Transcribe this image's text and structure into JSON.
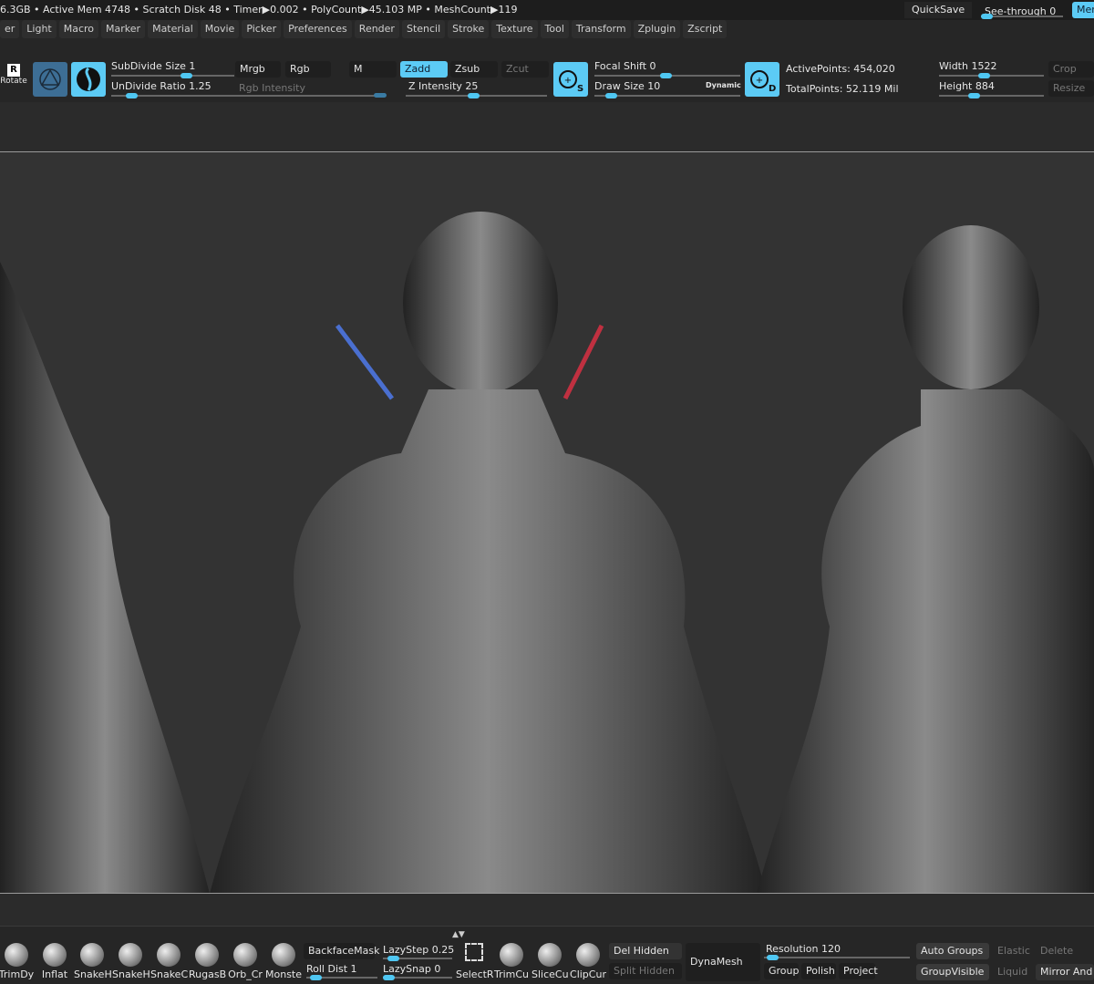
{
  "status": {
    "text": "6.3GB • Active Mem 4748 • Scratch Disk 48 •  Timer▶0.002 • PolyCount▶45.103 MP  • MeshCount▶119",
    "quicksave": "QuickSave",
    "see_through": "See-through  0",
    "see_through_value": 0,
    "menus_button": "Men"
  },
  "menubar": [
    "er",
    "Light",
    "Macro",
    "Marker",
    "Material",
    "Movie",
    "Picker",
    "Preferences",
    "Render",
    "Stencil",
    "Stroke",
    "Texture",
    "Tool",
    "Transform",
    "Zplugin",
    "Zscript"
  ],
  "shelf": {
    "rotate": "Rotate",
    "subdivide_size": "SubDivide Size 1",
    "undivide_ratio": "UnDivide Ratio 1.25",
    "mrgb": "Mrgb",
    "rgb": "Rgb",
    "rgb_intensity": "Rgb Intensity",
    "m": "M",
    "zadd": "Zadd",
    "zsub": "Zsub",
    "zcut": "Zcut",
    "z_intensity": "Z Intensity 25",
    "focal_shift": "Focal Shift 0",
    "draw_size": "Draw Size 10",
    "dynamic": "Dynamic",
    "active_points": "ActivePoints: 454,020",
    "total_points": "TotalPoints: 52.119 Mil",
    "width": "Width 1522",
    "height": "Height 884",
    "crop": "Crop",
    "resize": "Resize",
    "icon_s": "S",
    "icon_d": "D",
    "accent": "#5ccbf5"
  },
  "bottom": {
    "brushes": [
      "TrimDy",
      "Inflat",
      "SnakeH",
      "SnakeH",
      "SnakeC",
      "RugasB",
      "Orb_Cr",
      "Monste"
    ],
    "backface_mask": "BackfaceMask",
    "roll_dist": "Roll Dist 1",
    "lazy_step": "LazyStep 0.25",
    "lazy_snap": "LazySnap 0",
    "tools": [
      "SelectR",
      "TrimCu",
      "SliceCu",
      "ClipCur"
    ],
    "del_hidden": "Del Hidden",
    "split_hidden": "Split Hidden",
    "dynamesh": "DynaMesh",
    "resolution": "Resolution 120",
    "groups": "Groups",
    "polish": "Polish",
    "project": "Project",
    "auto_groups": "Auto Groups",
    "group_visible": "GroupVisible",
    "elastic": "Elastic",
    "liquid": "Liquid",
    "delete": "Delete",
    "mirror_and": "Mirror And"
  }
}
